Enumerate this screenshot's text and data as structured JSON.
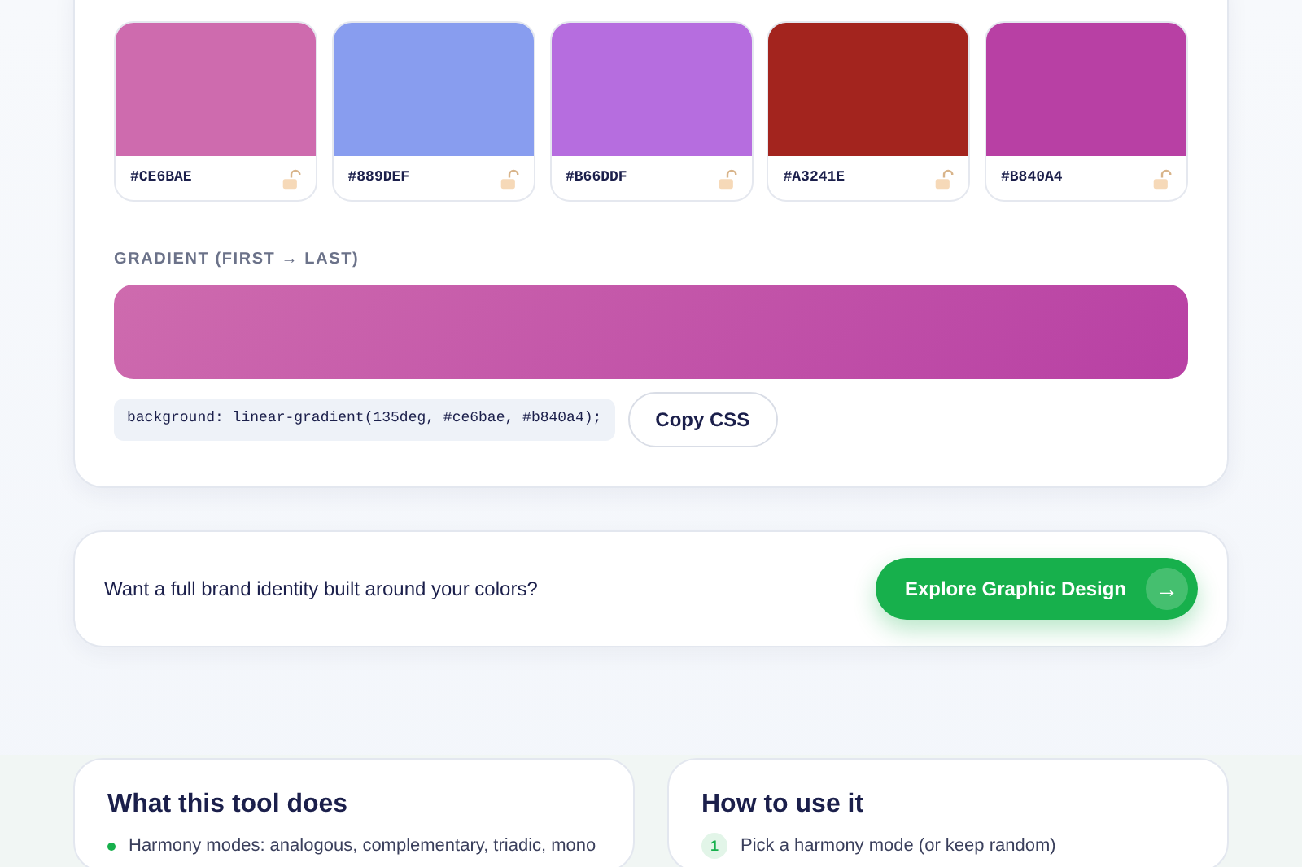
{
  "palette": {
    "swatches": [
      {
        "hex": "#CE6BAE",
        "color": "#ce6bae",
        "locked": false
      },
      {
        "hex": "#889DEF",
        "color": "#889def",
        "locked": false
      },
      {
        "hex": "#B66DDF",
        "color": "#b66ddf",
        "locked": false
      },
      {
        "hex": "#A3241E",
        "color": "#a3241e",
        "locked": false
      },
      {
        "hex": "#B840A4",
        "color": "#b840a4",
        "locked": false
      }
    ],
    "gradient": {
      "label": "GRADIENT (FIRST → LAST)",
      "css": "background: linear-gradient(135deg, #ce6bae, #b840a4);",
      "copy_button": "Copy CSS"
    }
  },
  "cta": {
    "text": "Want a full brand identity built around your colors?",
    "button": "Explore Graphic Design",
    "button_icon": "→"
  },
  "info_cards": [
    {
      "title": "What this tool does",
      "first_item": "Harmony modes: analogous, complementary, triadic, mono"
    },
    {
      "title": "How to use it",
      "first_step_number": "1",
      "first_item": "Pick a harmony mode (or keep random)"
    }
  ]
}
